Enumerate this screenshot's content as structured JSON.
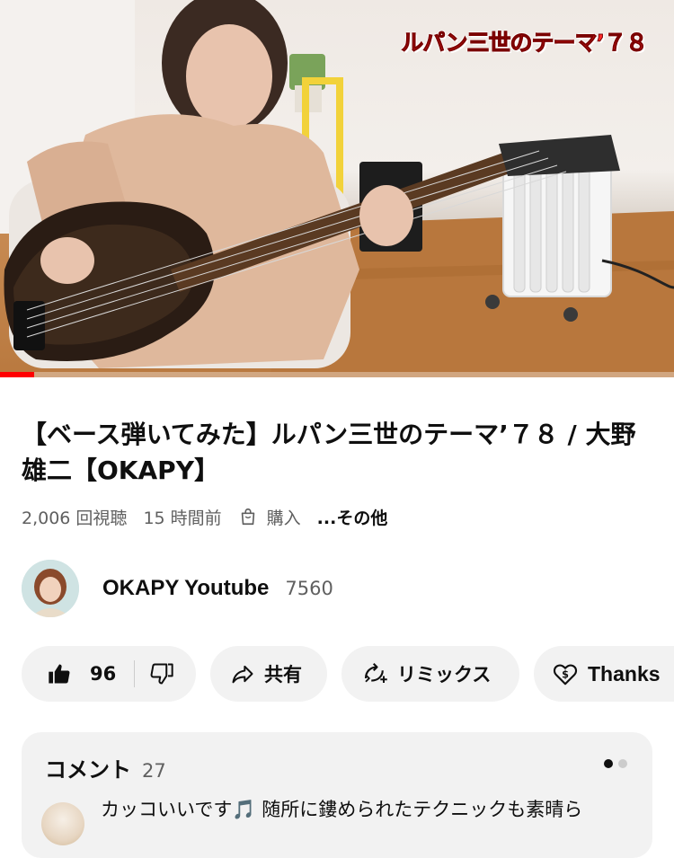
{
  "video": {
    "overlay_title": "ルパン三世のテーマ’７８",
    "progress_fraction": 0.05,
    "colors": {
      "progress": "#ff0000",
      "overlay_text": "#ff2a2a"
    }
  },
  "title": "【ベース弾いてみた】ルパン三世のテーマ’７８ / 大野雄二【OKAPY】",
  "meta": {
    "views": "2,006 回視聴",
    "age": "15 時間前",
    "bag_icon": "shopping-bag-icon",
    "buy_label": "購入",
    "more_label": "...その他"
  },
  "channel": {
    "name": "OKAPY Youtube",
    "subscribers": "7560"
  },
  "actions": {
    "like_icon": "thumbs-up-icon",
    "like_count": "96",
    "dislike_icon": "thumbs-down-icon",
    "share_icon": "share-arrow-icon",
    "share_label": "共有",
    "remix_icon": "remix-icon",
    "remix_label": "リミックス",
    "thanks_icon": "heart-dollar-icon",
    "thanks_label": "Thanks"
  },
  "comments": {
    "label": "コメント",
    "count": "27",
    "first_comment": "カッコいいです🎵 随所に鏤められたテクニックも素晴ら",
    "pager_dots": 2,
    "active_dot": 1
  }
}
